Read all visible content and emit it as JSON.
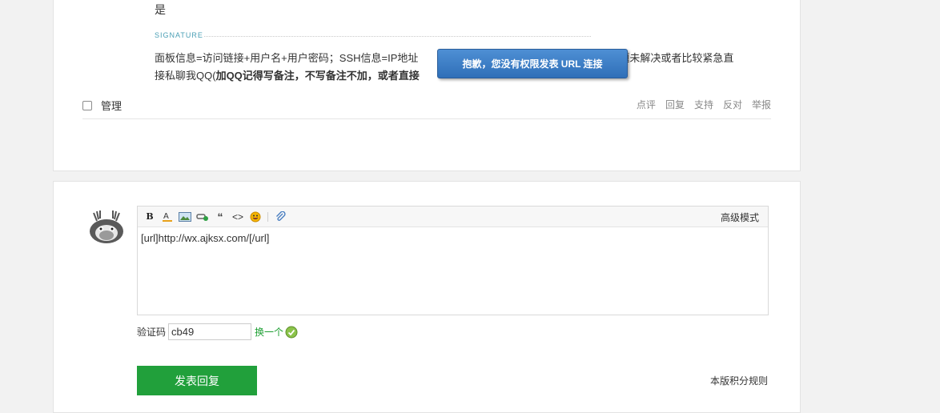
{
  "post": {
    "answer_text": "是",
    "signature_label": "SIGNATURE",
    "signature_line1": "面板信息=访问链接+用户名+用户密码；SSH信息=IP地址",
    "signature_line1_end": "问题未解决或者比较紧急直",
    "signature_line2_prefix": "接私聊我QQ(",
    "signature_line2_bold": "加QQ记得写备注，不写备注不加，或者直接"
  },
  "manage": {
    "label": "管理"
  },
  "actions": {
    "comment": "点评",
    "reply": "回复",
    "support": "支持",
    "oppose": "反对",
    "report": "举报"
  },
  "tooltip": {
    "text": "抱歉，您没有权限发表 URL 连接"
  },
  "editor": {
    "advanced_mode": "高级模式",
    "content": "[url]http://wx.ajksx.com/[/url]",
    "tools": [
      "bold-icon",
      "font-color-icon",
      "image-icon",
      "link-icon",
      "quote-icon",
      "code-icon",
      "emoji-icon",
      "attachment-icon"
    ]
  },
  "captcha": {
    "label": "验证码",
    "value": "cb49",
    "refresh": "换一个"
  },
  "submit": {
    "label": "发表回复"
  },
  "rules": {
    "label": "本版积分规则"
  },
  "colors": {
    "accent_green": "#21a03b",
    "tooltip_blue": "#3a7cc6",
    "signature_teal": "#4a9fb5"
  }
}
